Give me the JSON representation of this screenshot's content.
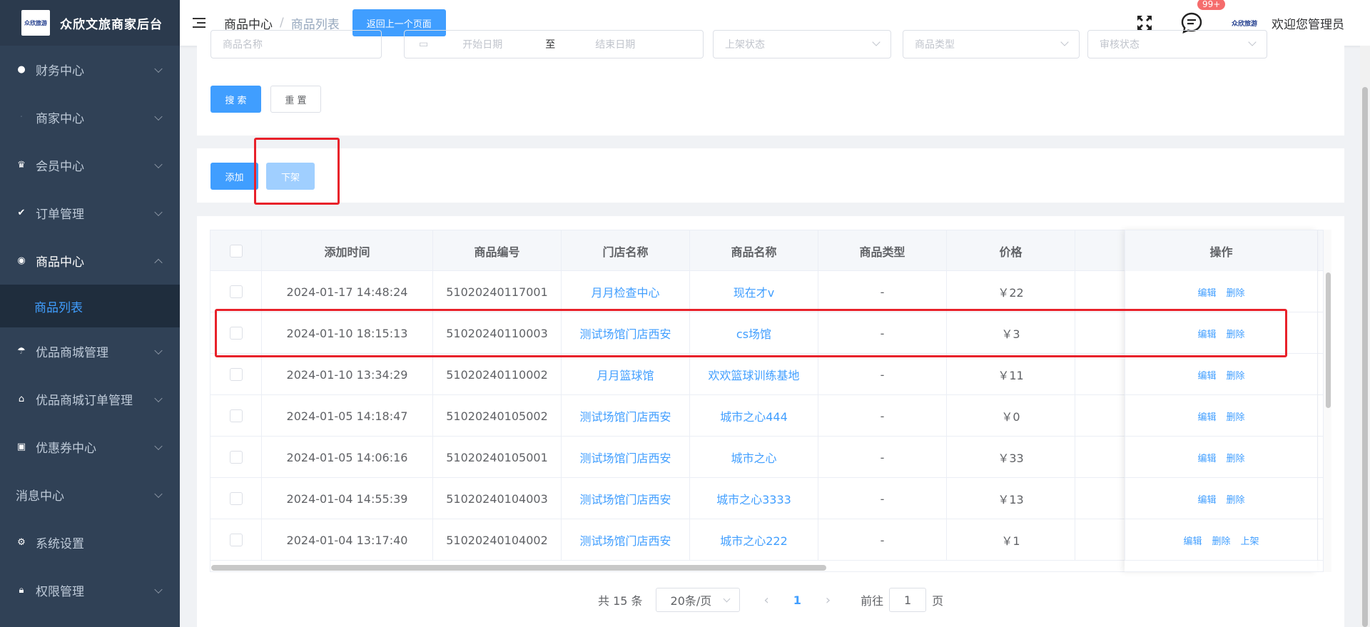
{
  "app": {
    "title": "众欣文旅商家后台",
    "logo_text": "众欣旅游",
    "mini_logo_text": "众欣旅游"
  },
  "sidebar": {
    "items": [
      {
        "label": "财务中心",
        "icon": "money-bag-icon"
      },
      {
        "label": "商家中心",
        "icon": "store-icon"
      },
      {
        "label": "会员中心",
        "icon": "crown-icon"
      },
      {
        "label": "订单管理",
        "icon": "clipboard-check-icon"
      },
      {
        "label": "商品中心",
        "icon": "goods-icon"
      },
      {
        "label": "优品商城管理",
        "icon": "mall-icon"
      },
      {
        "label": "优品商城订单管理",
        "icon": "mall-order-icon"
      },
      {
        "label": "优惠券中心",
        "icon": "coupon-icon"
      },
      {
        "label": "消息中心",
        "icon": ""
      },
      {
        "label": "系统设置",
        "icon": "gear-icon"
      },
      {
        "label": "权限管理",
        "icon": "lock-icon"
      }
    ],
    "active_sub": "商品列表"
  },
  "header": {
    "breadcrumb": [
      "商品中心",
      "商品列表"
    ],
    "back_button": "返回上一个页面",
    "badge": "99+",
    "welcome": "欢迎您管理员"
  },
  "filters": {
    "name_placeholder": "商品名称",
    "start_date_placeholder": "开始日期",
    "range_sep": "至",
    "end_date_placeholder": "结束日期",
    "listing_status_placeholder": "上架状态",
    "type_placeholder": "商品类型",
    "review_status_placeholder": "审核状态",
    "search_button": "搜 索",
    "reset_button": "重 置"
  },
  "actions": {
    "add_button": "添加",
    "delist_button": "下架"
  },
  "table": {
    "headers": [
      "添加时间",
      "商品编号",
      "门店名称",
      "商品名称",
      "商品类型",
      "价格",
      "操作"
    ],
    "edit_label": "编辑",
    "delete_label": "删除",
    "list_label": "上架",
    "rows": [
      {
        "time": "2024-01-17 14:48:24",
        "code": "51020240117001",
        "store": "月月检查中心",
        "name": "现在才v",
        "type": "-",
        "price": "￥22",
        "extra": ""
      },
      {
        "time": "2024-01-10 18:15:13",
        "code": "51020240110003",
        "store": "测试场馆门店西安",
        "name": "cs场馆",
        "type": "-",
        "price": "￥3",
        "extra": ""
      },
      {
        "time": "2024-01-10 13:34:29",
        "code": "51020240110002",
        "store": "月月篮球馆",
        "name": "欢欢篮球训练基地",
        "type": "-",
        "price": "￥11",
        "extra": ""
      },
      {
        "time": "2024-01-05 14:18:47",
        "code": "51020240105002",
        "store": "测试场馆门店西安",
        "name": "城市之心444",
        "type": "-",
        "price": "￥0",
        "extra": ""
      },
      {
        "time": "2024-01-05 14:06:16",
        "code": "51020240105001",
        "store": "测试场馆门店西安",
        "name": "城市之心",
        "type": "-",
        "price": "￥33",
        "extra": ""
      },
      {
        "time": "2024-01-04 14:55:39",
        "code": "51020240104003",
        "store": "测试场馆门店西安",
        "name": "城市之心3333",
        "type": "-",
        "price": "￥13",
        "extra": ""
      },
      {
        "time": "2024-01-04 13:17:40",
        "code": "51020240104002",
        "store": "测试场馆门店西安",
        "name": "城市之心222",
        "type": "-",
        "price": "￥1",
        "extra": "上架"
      }
    ]
  },
  "pagination": {
    "total": "共 15 条",
    "page_size": "20条/页",
    "current": "1",
    "goto_prefix": "前往",
    "goto_value": "1",
    "goto_suffix": "页"
  },
  "colors": {
    "primary": "#409eff",
    "sidebar": "#304156",
    "highlight": "#e8212a"
  }
}
